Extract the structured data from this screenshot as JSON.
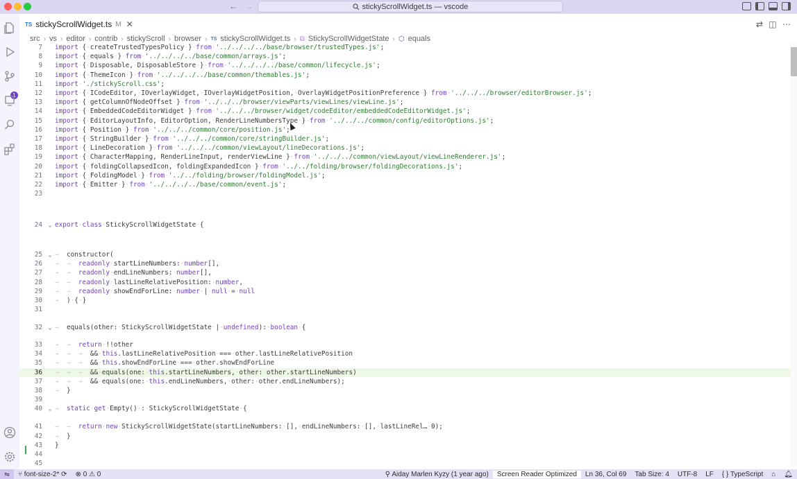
{
  "window": {
    "title": "stickyScrollWidget.ts — vscode"
  },
  "titlebar": {
    "back_icon": "arrow-left-icon",
    "forward_icon": "arrow-right-icon",
    "search_icon": "search-icon"
  },
  "tab": {
    "type_badge": "TS",
    "filename": "stickyScrollWidget.ts",
    "modified_flag": "M",
    "close_glyph": "✕"
  },
  "breadcrumb": {
    "parts": [
      "src",
      "vs",
      "editor",
      "contrib",
      "stickyScroll",
      "browser",
      "stickyScrollWidget.ts",
      "StickyScrollWidgetState",
      "equals"
    ],
    "file_badge": "TS",
    "separator": "›"
  },
  "activity": {
    "scm_badge": "1"
  },
  "editor": {
    "lines": [
      {
        "n": "7",
        "fold": "",
        "code": "import·{·createTrustedTypesPolicy·}·from·'../../../../base/browser/trustedTypes.js';"
      },
      {
        "n": "8",
        "fold": "",
        "code": "import·{·equals·}·from·'../../../../base/common/arrays.js';"
      },
      {
        "n": "9",
        "fold": "",
        "code": "import·{·Disposable,·DisposableStore·}·from·'../../../../base/common/lifecycle.js';"
      },
      {
        "n": "10",
        "fold": "",
        "code": "import·{·ThemeIcon·}·from·'../../../../base/common/themables.js';"
      },
      {
        "n": "11",
        "fold": "",
        "code": "import·'./stickyScroll.css';"
      },
      {
        "n": "12",
        "fold": "",
        "code": "import·{·ICodeEditor,·IOverlayWidget,·IOverlayWidgetPosition,·OverlayWidgetPositionPreference·}·from·'../../../browser/editorBrowser.js';"
      },
      {
        "n": "13",
        "fold": "",
        "code": "import·{·getColumnOfNodeOffset·}·from·'../../../browser/viewParts/viewLines/viewLine.js';"
      },
      {
        "n": "14",
        "fold": "",
        "code": "import·{·EmbeddedCodeEditorWidget·}·from·'../../../browser/widget/codeEditor/embeddedCodeEditorWidget.js';"
      },
      {
        "n": "15",
        "fold": "",
        "code": "import·{·EditorLayoutInfo,·EditorOption,·RenderLineNumbersType·}·from·'../../../common/config/editorOptions.js';"
      },
      {
        "n": "16",
        "fold": "",
        "code": "import·{·Position·}·from·'../../../common/core/position.js';"
      },
      {
        "n": "17",
        "fold": "",
        "code": "import·{·StringBuilder·}·from·'../../../common/core/stringBuilder.js';"
      },
      {
        "n": "18",
        "fold": "",
        "code": "import·{·LineDecoration·}·from·'../../../common/viewLayout/lineDecorations.js';"
      },
      {
        "n": "19",
        "fold": "",
        "code": "import·{·CharacterMapping,·RenderLineInput,·renderViewLine·}·from·'../../../common/viewLayout/viewLineRenderer.js';"
      },
      {
        "n": "20",
        "fold": "",
        "code": "import·{·foldingCollapsedIcon,·foldingExpandedIcon·}·from·'../../folding/browser/foldingDecorations.js';"
      },
      {
        "n": "21",
        "fold": "",
        "code": "import·{·FoldingModel·}·from·'../../folding/browser/foldingModel.js';"
      },
      {
        "n": "22",
        "fold": "",
        "code": "import·{·Emitter·}·from·'../../../../base/common/event.js';"
      },
      {
        "n": "23",
        "fold": "",
        "code": ""
      },
      {
        "n": "24",
        "fold": "⌄",
        "code": "export·class·StickyScrollWidgetState·{"
      },
      {
        "n": "25",
        "fold": "⌄",
        "code": "→  constructor("
      },
      {
        "n": "26",
        "fold": "",
        "code": "→  →  readonly·startLineNumbers:·number[],"
      },
      {
        "n": "27",
        "fold": "",
        "code": "→  →  readonly·endLineNumbers:·number[],"
      },
      {
        "n": "28",
        "fold": "",
        "code": "→  →  readonly·lastLineRelativePosition:·number,"
      },
      {
        "n": "29",
        "fold": "",
        "code": "→  →  readonly·showEndForLine:·number·|·null·=·null"
      },
      {
        "n": "30",
        "fold": "",
        "code": "→  )·{·}"
      },
      {
        "n": "31",
        "fold": "",
        "code": ""
      },
      {
        "n": "32",
        "fold": "⌄",
        "code": "→  equals(other:·StickyScrollWidgetState·|·undefined):·boolean·{"
      },
      {
        "n": "33",
        "fold": "",
        "code": "→  →  return·!!other"
      },
      {
        "n": "34",
        "fold": "",
        "code": "→  →  →  &&·this.lastLineRelativePosition·===·other.lastLineRelativePosition"
      },
      {
        "n": "35",
        "fold": "",
        "code": "→  →  →  &&·this.showEndForLine·===·other.showEndForLine"
      },
      {
        "n": "36",
        "fold": "",
        "code": "→  →  →  &&·equals(one:·this.startLineNumbers,·other:·other.startLineNumbers)"
      },
      {
        "n": "37",
        "fold": "",
        "code": "→  →  →  &&·equals(one:·this.endLineNumbers,·other:·other.endLineNumbers);"
      },
      {
        "n": "38",
        "fold": "",
        "code": "→  }"
      },
      {
        "n": "39",
        "fold": "",
        "code": ""
      },
      {
        "n": "40",
        "fold": "⌄",
        "code": "→  static·get·Empty()·:·StickyScrollWidgetState·{"
      },
      {
        "n": "41",
        "fold": "",
        "code": "→  →  return·new·StickyScrollWidgetState(startLineNumbers:·[],·endLineNumbers:·[],·lastLineRel…·0);"
      },
      {
        "n": "42",
        "fold": "",
        "code": "→  }"
      },
      {
        "n": "43",
        "fold": "",
        "code": "}"
      },
      {
        "n": "44",
        "fold": "",
        "code": ""
      },
      {
        "n": "45",
        "fold": "",
        "code": ""
      }
    ]
  },
  "statusbar": {
    "remote_icon": "remote-icon",
    "branch": "font-size-2*",
    "sync_icon": "sync-icon",
    "errors": "0",
    "warnings": "0",
    "blame": "Aiday Marlen Kyzy (1 year ago)",
    "screen_reader": "Screen Reader Optimized",
    "position": "Ln 36, Col 69",
    "tab_size": "Tab Size: 4",
    "encoding": "UTF-8",
    "eol": "LF",
    "language": "TypeScript"
  }
}
